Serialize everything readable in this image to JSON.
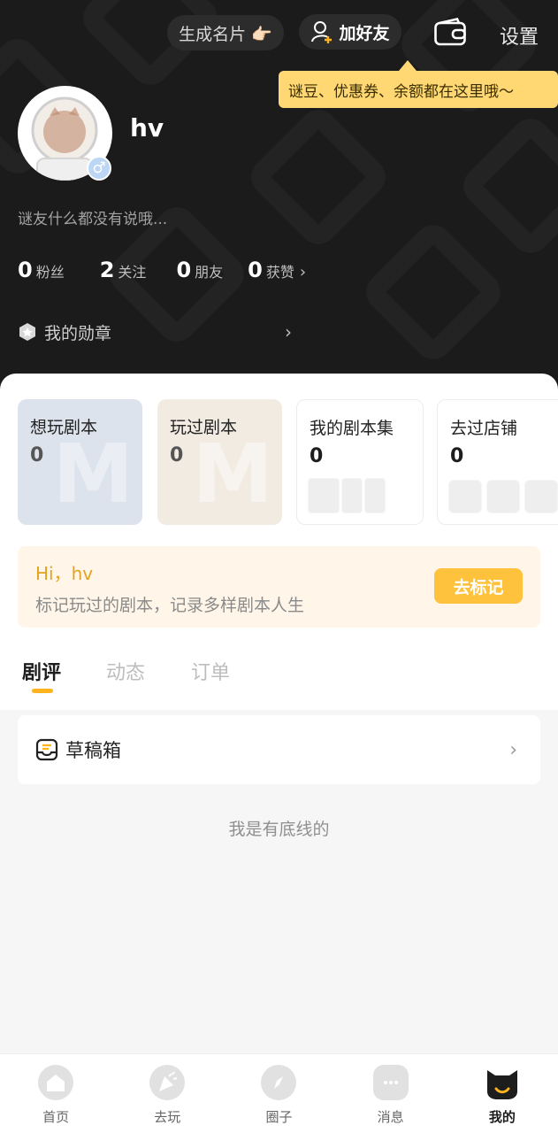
{
  "header": {
    "card_button": "生成名片 👉🏻",
    "add_friend_button": "加好友",
    "settings_label": "设置",
    "tooltip": "谜豆、优惠券、余额都在这里哦～"
  },
  "profile": {
    "username": "hv",
    "gender_symbol": "♂",
    "bio": "谜友什么都没有说哦...",
    "stats": [
      {
        "value": "0",
        "label": "粉丝"
      },
      {
        "value": "2",
        "label": "关注"
      },
      {
        "value": "0",
        "label": "朋友"
      },
      {
        "value": "0",
        "label": "获赞"
      }
    ],
    "stats_arrow": "›",
    "badges_label": "我的勋章",
    "badges_arrow": "›"
  },
  "cards": [
    {
      "title": "想玩剧本",
      "count": "0"
    },
    {
      "title": "玩过剧本",
      "count": "0"
    },
    {
      "title": "我的剧本集",
      "count": "0"
    },
    {
      "title": "去过店铺",
      "count": "0"
    }
  ],
  "promo": {
    "greeting": "Hi，hv",
    "description": "标记玩过的剧本，记录多样剧本人生",
    "button": "去标记"
  },
  "tabs": [
    "剧评",
    "动态",
    "订单"
  ],
  "drafts": {
    "label": "草稿箱",
    "arrow": "›"
  },
  "bottom_text": "我是有底线的",
  "nav": [
    "首页",
    "去玩",
    "圈子",
    "消息",
    "我的"
  ],
  "colors": {
    "accent": "#ffb41f",
    "tooltip": "#ffd873",
    "header_bg": "#1b1b1b"
  }
}
